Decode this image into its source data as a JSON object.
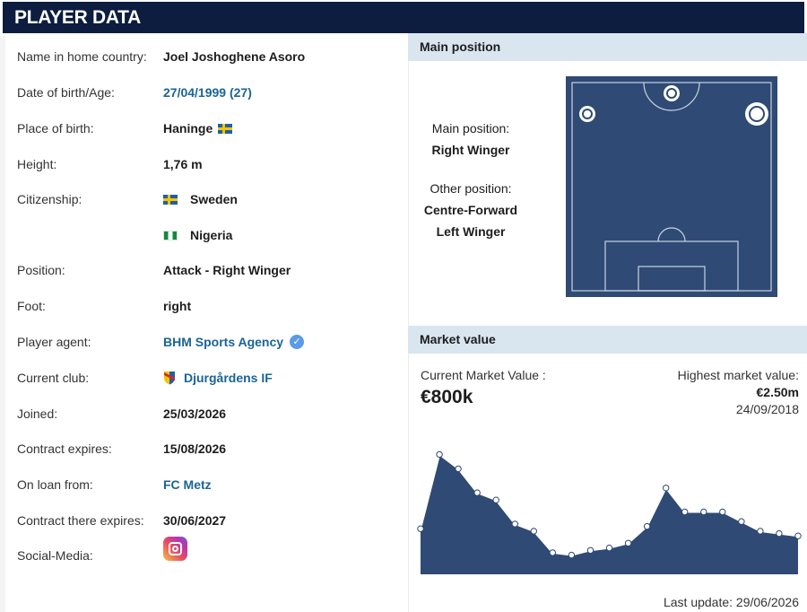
{
  "header": {
    "title": "PLAYER DATA"
  },
  "player": {
    "rows": [
      {
        "label": "Name in home country:",
        "value": "Joel Joshoghene Asoro"
      },
      {
        "label": "Date of birth/Age:",
        "value": "27/04/1999 (27)"
      },
      {
        "label": "Place of birth:",
        "value": "Haninge"
      },
      {
        "label": "Height:",
        "value": "1,76 m"
      },
      {
        "label": "Citizenship:",
        "value": "Sweden",
        "value2": "Nigeria"
      },
      {
        "label": "Position:",
        "value": "Attack - Right Winger"
      },
      {
        "label": "Foot:",
        "value": "right"
      },
      {
        "label": "Player agent:",
        "value": "BHM Sports Agency"
      },
      {
        "label": "Current club:",
        "value": "Djurgårdens IF"
      },
      {
        "label": "Joined:",
        "value": "25/03/2026"
      },
      {
        "label": "Contract expires:",
        "value": "15/08/2026"
      },
      {
        "label": "On loan from:",
        "value": "FC Metz"
      },
      {
        "label": "Contract there expires:",
        "value": "30/06/2027"
      },
      {
        "label": "Social-Media:",
        "value": ""
      }
    ],
    "icons": {
      "birth_flag": "sweden-flag-icon",
      "citizenship_flags": [
        "sweden-flag-icon",
        "nigeria-flag-icon"
      ],
      "agent_badge": "verified-check-icon",
      "club_icon": "djurgarden-crest-icon",
      "social": "instagram-icon"
    }
  },
  "position": {
    "heading": "Main position",
    "main_label": "Main position:",
    "main_value": "Right Winger",
    "other_label": "Other position:",
    "other_values": [
      "Centre-Forward",
      "Left Winger"
    ],
    "pitch_color": "#2f4a74"
  },
  "market": {
    "heading": "Market value",
    "current_label": "Current Market Value :",
    "current_value": "€800k",
    "highest_label": "Highest market value:",
    "highest_value": "€2.50m",
    "highest_date": "24/09/2018",
    "last_update": "Last update: 29/06/2026",
    "fill_color": "#2f4a74",
    "chart_data": {
      "type": "area",
      "series": [
        {
          "values": [
            0.95,
            2.5,
            2.2,
            1.7,
            1.55,
            1.05,
            0.9,
            0.45,
            0.4,
            0.5,
            0.55,
            0.65,
            1.0,
            1.8,
            1.3,
            1.3,
            1.3,
            1.1,
            0.9,
            0.85,
            0.8
          ]
        }
      ],
      "ylim": [
        0,
        2.9
      ]
    }
  }
}
